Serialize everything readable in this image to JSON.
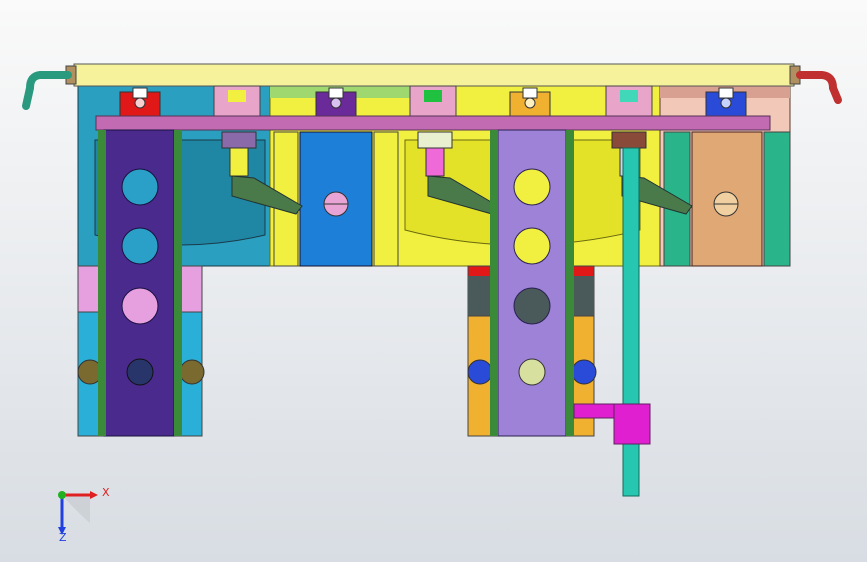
{
  "viewport": {
    "background_top": "#fafafa",
    "background_bottom": "#d8dde3"
  },
  "triad": {
    "x_label": "X",
    "z_label": "Z",
    "x_color": "#e02020",
    "y_color": "#20b020",
    "z_color": "#2040e0"
  },
  "model": {
    "rail_color": "#f6f29c",
    "handle_left_color": "#2a9a7e",
    "handle_right_color": "#c03030",
    "plate_color": "#c26bb3",
    "left_block_color": "#2a9fbf",
    "middle_block_color": "#f1f040",
    "right_block_color": "#f2c8b8",
    "tower_left_color": "#4b2a8e",
    "tower_right_color": "#9d82d8",
    "guide_rod_color": "#26c6b0",
    "bracket_color": "#e020d0",
    "sensor_colors": [
      "#e01818",
      "#6a2a9a",
      "#f0b030",
      "#2a4ad8"
    ],
    "clamp_arm_color": "#4a7a4a"
  }
}
